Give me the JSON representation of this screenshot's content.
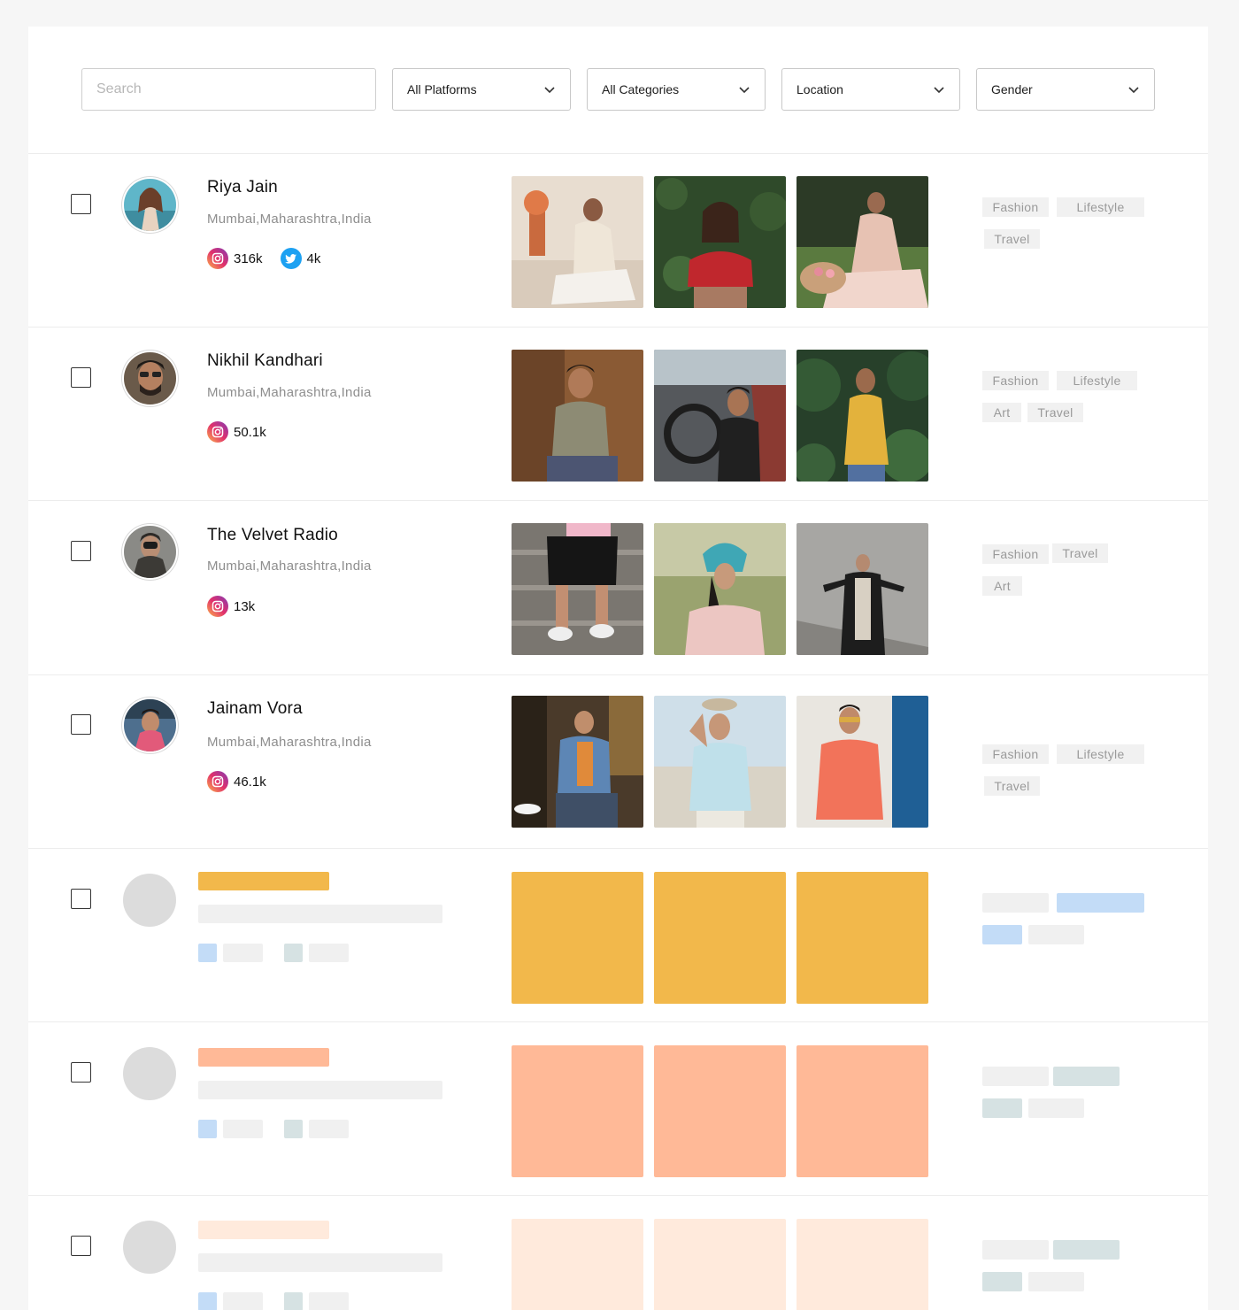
{
  "filters": {
    "search_placeholder": "Search",
    "platforms": "All Platforms",
    "categories": "All Categories",
    "location": "Location",
    "gender": "Gender"
  },
  "influencers": [
    {
      "name": "Riya Jain",
      "location": "Mumbai,Maharashtra,India",
      "stats": [
        {
          "platform": "instagram-icon",
          "count": "316k"
        },
        {
          "platform": "twitter-icon",
          "count": "4k"
        }
      ],
      "tags": [
        "Fashion",
        "Lifestyle",
        "Travel"
      ]
    },
    {
      "name": "Nikhil Kandhari",
      "location": "Mumbai,Maharashtra,India",
      "stats": [
        {
          "platform": "instagram-icon",
          "count": "50.1k"
        }
      ],
      "tags": [
        "Fashion",
        "Lifestyle",
        "Art",
        "Travel"
      ]
    },
    {
      "name": "The Velvet Radio",
      "location": "Mumbai,Maharashtra,India",
      "stats": [
        {
          "platform": "instagram-icon",
          "count": "13k"
        }
      ],
      "tags": [
        "Fashion",
        "Travel",
        "Art"
      ]
    },
    {
      "name": "Jainam Vora",
      "location": "Mumbai,Maharashtra,India",
      "stats": [
        {
          "platform": "instagram-icon",
          "count": "46.1k"
        }
      ],
      "tags": [
        "Fashion",
        "Lifestyle",
        "Travel"
      ]
    }
  ],
  "placeholders": [
    {
      "accent": "#f2b84b",
      "name_bar": "#f2b84b",
      "tag_a": "#f0f0f0",
      "tag_b": "#c3dcf7",
      "tag_c": "#c3dcf7",
      "tag_d": "#f0f0f0"
    },
    {
      "accent": "#ffb997",
      "name_bar": "#ffb997",
      "tag_a": "#f0f0f0",
      "tag_b": "#d6e2e3",
      "tag_c": "#d6e2e3",
      "tag_d": "#f0f0f0"
    },
    {
      "accent": "#ffeadc",
      "name_bar": "#ffeadc",
      "tag_a": "#f0f0f0",
      "tag_b": "#d6e2e3",
      "tag_c": "#d6e2e3",
      "tag_d": "#f0f0f0"
    }
  ],
  "colors": {
    "skeleton_gray": "#f0f0f0",
    "skeleton_blue": "#c3dcf7",
    "skeleton_teal": "#d6e2e3",
    "instagram": "#e1306c",
    "twitter": "#1da1f2"
  }
}
